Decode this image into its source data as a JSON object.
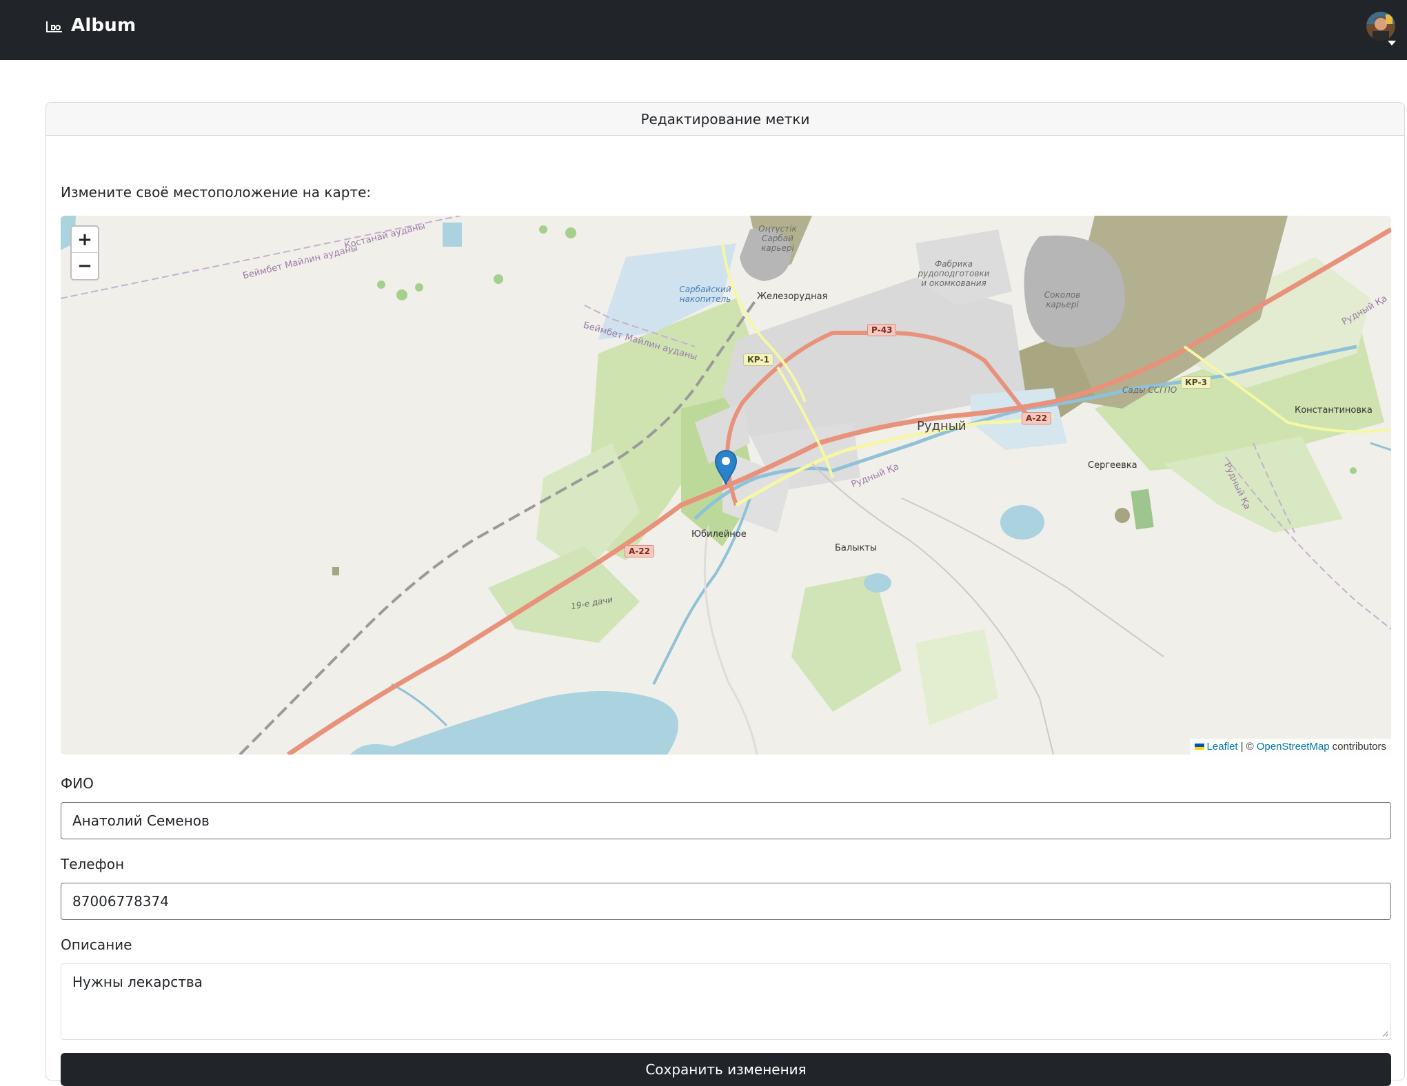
{
  "navbar": {
    "brand": "Album",
    "brand_icon": "camera-icon",
    "avatar_icon": "user-avatar"
  },
  "card": {
    "header": "Редактирование метки",
    "prompt": "Измените своё местоположение на карте:"
  },
  "map": {
    "zoom_in": "+",
    "zoom_out": "−",
    "attribution": {
      "leaflet": "Leaflet",
      "separator": "| ©",
      "osm": "OpenStreetMap",
      "suffix": "contributors"
    },
    "labels": {
      "rudny": "Рудный",
      "zhelezorudnaya": "Железорудная",
      "yubileynoe": "Юбилейное",
      "balykty": "Балыкты",
      "sergeevka": "Сергеевка",
      "konstantinovka": "Константиновка",
      "sady": "Сады ССГПО",
      "dachi": "19-е дачи",
      "sarbay_quarry": "Оңтүстік Сарбай карьері",
      "sarbay_reservoir": "Сарбайский накопитель",
      "factory": "Фабрика рудоподготовки и окомкования",
      "sokolov": "Соколов карьері",
      "kostanay_district": "Костанай ауданы",
      "maylin_district": "Беймбет Майлин ауданы",
      "maylin_district2": "Беймбет Майлин ауданы",
      "river": "Рудный Қа",
      "river2": "Рудный Қа",
      "river3": "Рудный Қа"
    },
    "shields": {
      "p43": "Р-43",
      "a22_center": "А-22",
      "a22_east": "А-22",
      "kp1": "КР-1",
      "kp3": "КР-3"
    }
  },
  "form": {
    "name_label": "ФИО",
    "name_value": "Анатолий Семенов",
    "phone_label": "Телефон",
    "phone_value": "87006778374",
    "description_label": "Описание",
    "description_value": "Нужны лекарства",
    "save_button": "Сохранить изменения"
  }
}
